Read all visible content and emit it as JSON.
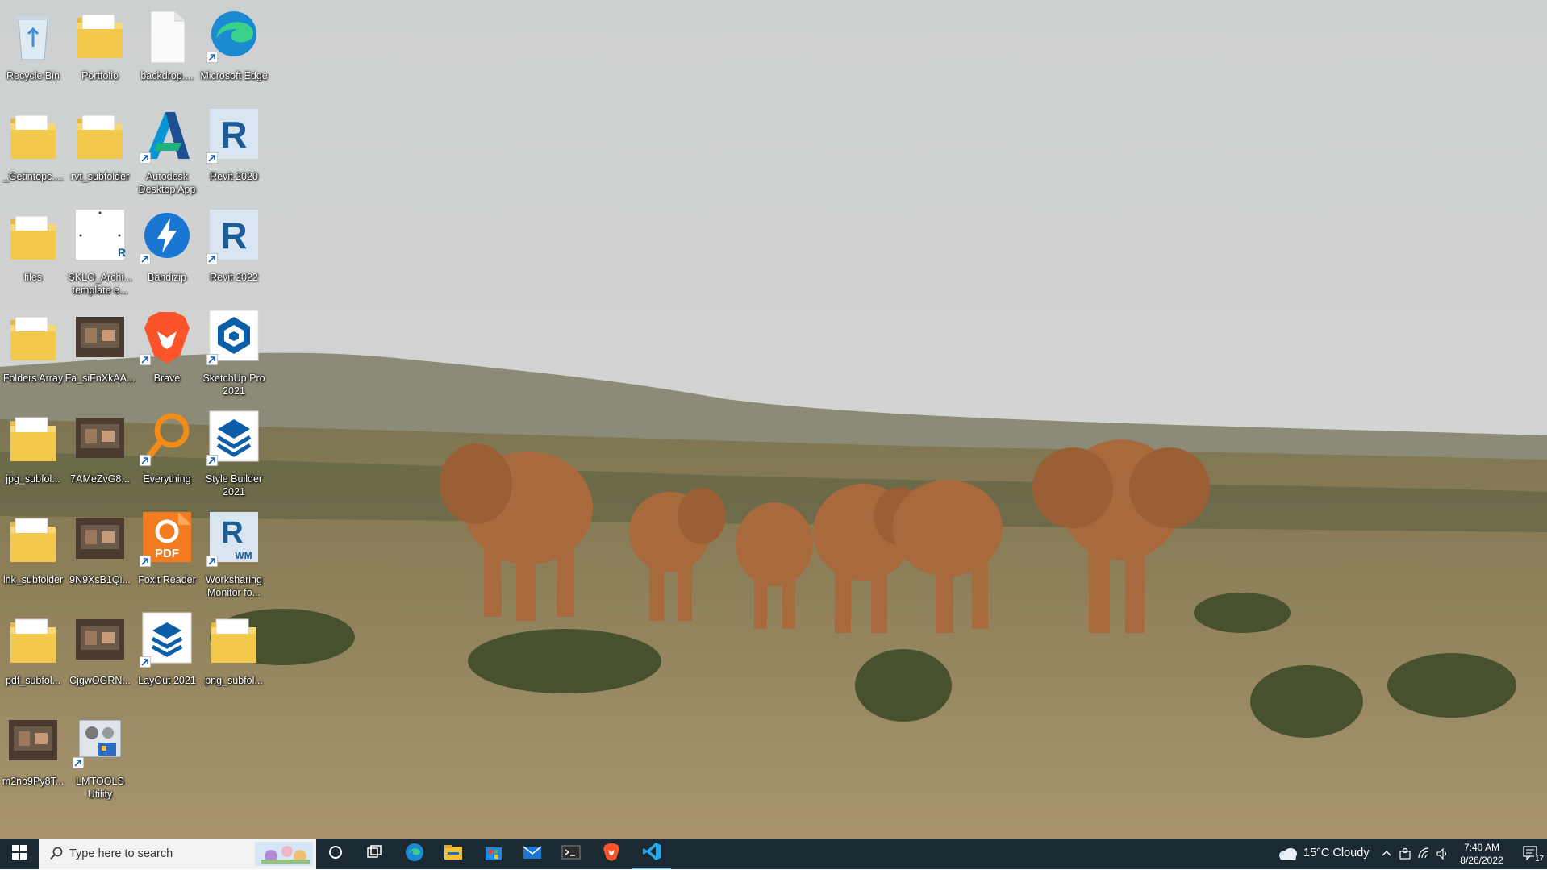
{
  "desktop": {
    "icons": [
      {
        "label": "Recycle Bin",
        "icon": "recycle-bin-icon"
      },
      {
        "label": "Portfolio",
        "icon": "folder-icon"
      },
      {
        "label": "backdrop....",
        "icon": "file-icon"
      },
      {
        "label": "Microsoft Edge",
        "icon": "edge-icon"
      },
      {
        "label": "_Getintopc....",
        "icon": "folder-icon"
      },
      {
        "label": "rvt_subfolder",
        "icon": "folder-icon"
      },
      {
        "label": "Autodesk Desktop App",
        "icon": "autodesk-icon"
      },
      {
        "label": "Revit 2020",
        "icon": "revit-icon"
      },
      {
        "label": "files",
        "icon": "folder-icon"
      },
      {
        "label": "SKLO_Archi... template e...",
        "icon": "revit-file-icon"
      },
      {
        "label": "Bandizip",
        "icon": "bandizip-icon"
      },
      {
        "label": "Revit 2022",
        "icon": "revit-icon"
      },
      {
        "label": "Folders Array",
        "icon": "folder-icon"
      },
      {
        "label": "Fa_siFnXkAA...",
        "icon": "image-thumbnail-icon"
      },
      {
        "label": "Brave",
        "icon": "brave-icon"
      },
      {
        "label": "SketchUp Pro 2021",
        "icon": "sketchup-icon"
      },
      {
        "label": "jpg_subfol...",
        "icon": "folder-icon"
      },
      {
        "label": "7AMeZvG8...",
        "icon": "image-thumbnail-icon"
      },
      {
        "label": "Everything",
        "icon": "everything-icon"
      },
      {
        "label": "Style Builder 2021",
        "icon": "style-builder-icon"
      },
      {
        "label": "lnk_subfolder",
        "icon": "folder-icon"
      },
      {
        "label": "9N9XsB1Qi...",
        "icon": "image-thumbnail-icon"
      },
      {
        "label": "Foxit Reader",
        "icon": "foxit-icon"
      },
      {
        "label": "Worksharing Monitor fo...",
        "icon": "worksharing-monitor-icon"
      },
      {
        "label": "pdf_subfol...",
        "icon": "folder-icon"
      },
      {
        "label": "CjgwOGRN...",
        "icon": "image-thumbnail-icon"
      },
      {
        "label": "LayOut 2021",
        "icon": "layout-icon"
      },
      {
        "label": "png_subfol...",
        "icon": "folder-icon"
      },
      {
        "label": "m2no9Py8T...",
        "icon": "image-thumbnail-icon"
      },
      {
        "label": "LMTOOLS Utility",
        "icon": "lmtools-icon"
      }
    ]
  },
  "taskbar": {
    "search_placeholder": "Type here to search",
    "pinned": [
      "start-icon",
      "cortana-icon",
      "task-view-icon",
      "edge-icon",
      "file-explorer-icon",
      "microsoft-store-icon",
      "mail-icon",
      "terminal-icon",
      "brave-icon",
      "vscode-icon"
    ],
    "weather": "15°C  Cloudy",
    "time": "7:40 AM",
    "date": "8/26/2022",
    "notification_count": "17"
  },
  "colors": {
    "taskbar": "#1b2a32",
    "accent": "#0078d4"
  }
}
